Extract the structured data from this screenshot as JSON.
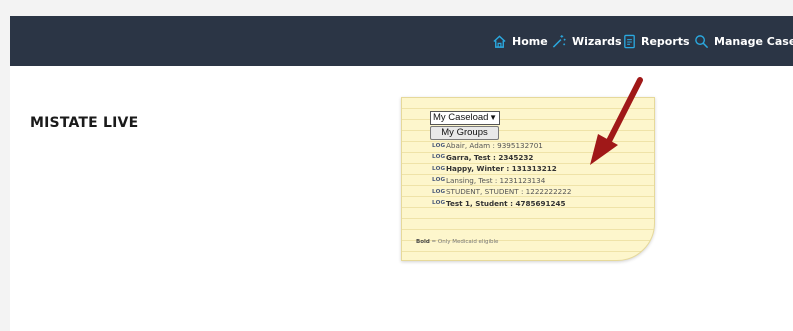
{
  "nav": {
    "home": "Home",
    "wizards": "Wizards",
    "reports": "Reports",
    "manage_caseload": "Manage Caseload"
  },
  "site": {
    "title": "MISTATE LIVE"
  },
  "caseload_widget": {
    "select_value": "My Caseload",
    "groups_button": "My Groups",
    "log_label": "LOG",
    "students": [
      {
        "name": "Abair, Adam : 9395132701",
        "bold": false
      },
      {
        "name": "Garra, Test : 2345232",
        "bold": true
      },
      {
        "name": "Happy, Winter : 131313212",
        "bold": true
      },
      {
        "name": "Lansing, Test : 1231123134",
        "bold": false
      },
      {
        "name": "STUDENT, STUDENT : 1222222222",
        "bold": false
      },
      {
        "name": "Test 1, Student : 4785691245",
        "bold": true
      }
    ],
    "legend_bold": "Bold",
    "legend_text": " = Only Medicaid eligible"
  },
  "colors": {
    "topbar": "#2b3545",
    "nav_icon": "#2aa9e0",
    "note_bg": "#fdf6cc",
    "arrow": "#a01818"
  }
}
